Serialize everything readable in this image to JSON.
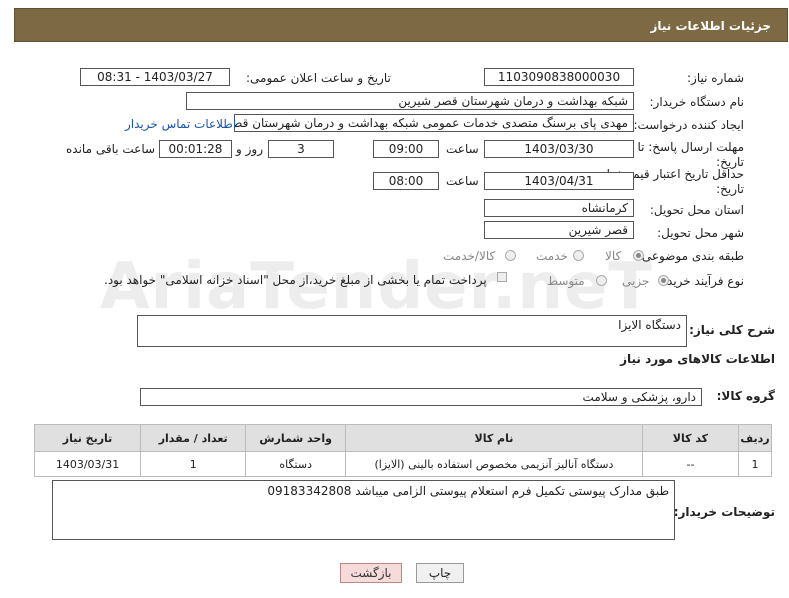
{
  "header": {
    "title": "جزئیات اطلاعات نیاز"
  },
  "watermark": "AriaTender.neT",
  "fields": {
    "need_number_label": "شماره نیاز:",
    "need_number": "1103090838000030",
    "announce_label": "تاریخ و ساعت اعلان عمومی:",
    "announce_value": "1403/03/27 - 08:31",
    "buyer_label": "نام دستگاه خریدار:",
    "buyer_value": "شبکه بهداشت و درمان شهرستان قصر شیرین",
    "creator_label": "ایجاد کننده درخواست:",
    "creator_value": "مهدی پای برسنگ متصدی خدمات عمومی شبکه بهداشت و درمان شهرستان قصر شیرین",
    "contact_link": "اطلاعات تماس خریدار",
    "deadline_label_1": "مهلت ارسال پاسخ: تا",
    "deadline_label_2": "تاریخ:",
    "deadline_date": "1403/03/30",
    "time_label": "ساعت",
    "deadline_time": "09:00",
    "days_value": "3",
    "days_label": "روز و",
    "remaining_value": "00:01:28",
    "remaining_label": "ساعت باقی مانده",
    "validity_label_1": "حداقل تاریخ اعتبار قیمت: تا",
    "validity_label_2": "تاریخ:",
    "validity_date": "1403/04/31",
    "validity_time": "08:00",
    "province_label": "استان محل تحویل:",
    "province_value": "کرمانشاه",
    "city_label": "شهر محل تحویل:",
    "city_value": "قصر شیرین",
    "category_label": "طبقه بندی موضوعی:",
    "category_options": [
      "کالا",
      "خدمت",
      "کالا/خدمت"
    ],
    "process_label": "نوع فرآیند خرید :",
    "process_options": [
      "جزیی",
      "متوسط"
    ],
    "payment_note": "پرداخت تمام یا بخشی از مبلغ خرید،از محل \"اسناد خزانه اسلامی\" خواهد بود.",
    "summary_label": "شرح کلی نیاز:",
    "summary_value": "دستگاه الایزا",
    "goods_info_title": "اطلاعات کالاهای مورد نیاز",
    "goods_group_label": "گروه کالا:",
    "goods_group_value": "دارو، پزشکی و سلامت",
    "buyer_notes_label": "توضیحات خریدار:",
    "buyer_notes_value": "طبق مدارک پیوستی تکمیل فرم استعلام پیوستی الزامی میباشد 09183342808"
  },
  "table": {
    "headers": [
      "ردیف",
      "کد کالا",
      "نام کالا",
      "واحد شمارش",
      "تعداد / مقدار",
      "تاریخ نیاز"
    ],
    "rows": [
      [
        "1",
        "--",
        "دستگاه آنالیز آنزیمی مخصوص استفاده بالینی (الایزا)",
        "دستگاه",
        "1",
        "1403/03/31"
      ]
    ]
  },
  "buttons": {
    "print": "چاپ",
    "back": "بازگشت"
  }
}
